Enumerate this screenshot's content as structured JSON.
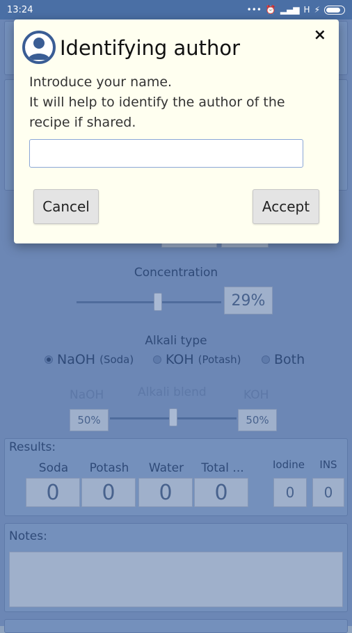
{
  "status_bar": {
    "time": "13:24",
    "network": "H"
  },
  "dialog": {
    "title": "Identifying author",
    "message_line1": "Introduce your name.",
    "message_line2": "It will help to identify the author of the recipe if shared.",
    "input_value": "",
    "input_placeholder": "",
    "cancel_label": "Cancel",
    "accept_label": "Accept",
    "close_glyph": "×"
  },
  "concentration": {
    "label": "Concentration",
    "value": "29%"
  },
  "alkali": {
    "label": "Alkali type",
    "options": [
      {
        "label": "NaOH",
        "sub": "(Soda)",
        "selected": true
      },
      {
        "label": "KOH",
        "sub": "(Potash)",
        "selected": false
      },
      {
        "label": "Both",
        "sub": "",
        "selected": false
      }
    ],
    "blend_label": "Alkali blend",
    "left_name": "NaOH",
    "right_name": "KOH",
    "left_value": "50%",
    "right_value": "50%"
  },
  "results": {
    "label": "Results:",
    "columns": [
      {
        "header": "Soda",
        "value": "0"
      },
      {
        "header": "Potash",
        "value": "0"
      },
      {
        "header": "Water",
        "value": "0"
      },
      {
        "header": "Total ...",
        "value": "0"
      }
    ],
    "extra": [
      {
        "header": "Iodine",
        "value": "0"
      },
      {
        "header": "INS",
        "value": "0"
      }
    ]
  },
  "notes": {
    "label": "Notes:",
    "value": ""
  }
}
